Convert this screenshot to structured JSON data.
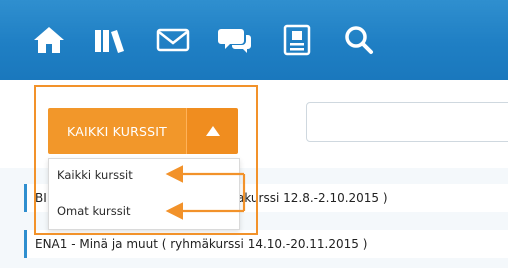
{
  "nav": {
    "icons": [
      {
        "name": "home-icon"
      },
      {
        "name": "library-icon"
      },
      {
        "name": "mail-icon"
      },
      {
        "name": "chat-icon"
      },
      {
        "name": "profile-card-icon"
      },
      {
        "name": "search-icon"
      }
    ],
    "colors": {
      "bar": "#1f7fc4",
      "icon": "#ffffff"
    }
  },
  "filter": {
    "selected_label": "KAIKKI KURSSIT",
    "toggle_icon": "triangle-up-icon",
    "options": [
      "Kaikki kurssit",
      "Omat kurssit"
    ],
    "accent": "#f2972a"
  },
  "courses": {
    "row1_left": "BI",
    "row1_right": "akurssi 12.8.-2.10.2015 )",
    "row2": "ENA1 - Minä ja muut ( ryhmäkurssi 14.10.-20.11.2015 )"
  },
  "annotation": {
    "color": "#f2922a"
  }
}
